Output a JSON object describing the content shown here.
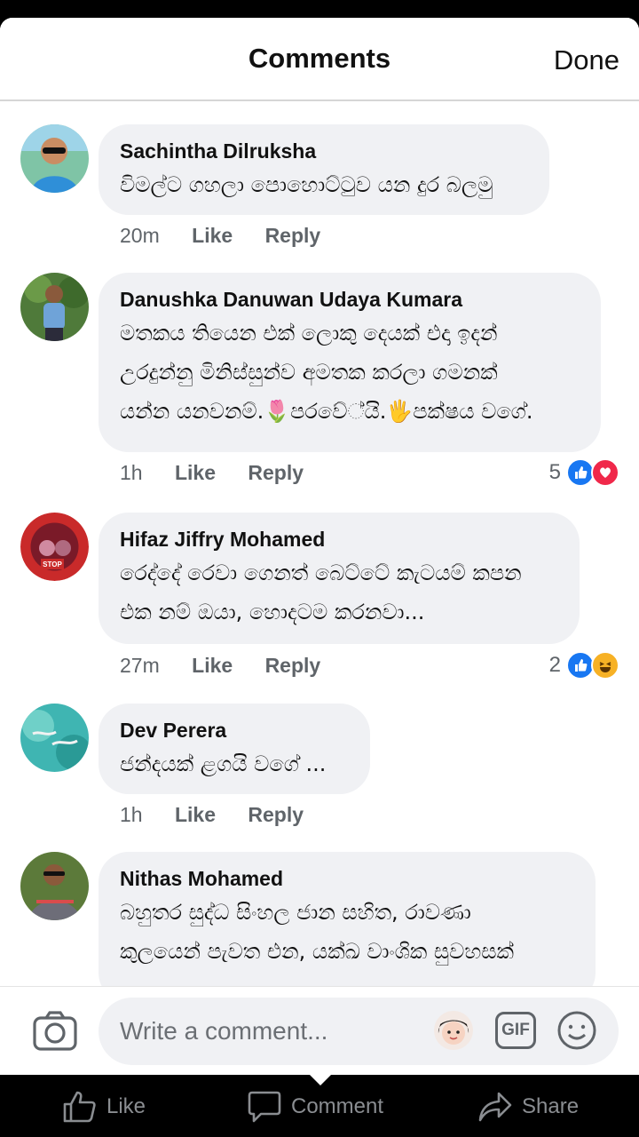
{
  "header": {
    "title": "Comments",
    "done_label": "Done"
  },
  "comments": [
    {
      "author": "Sachintha Dilruksha",
      "lines": [
        "විමල්ට ගහලා පොහොට්ටුව යන දුර බලමු"
      ],
      "time": "20m",
      "like_label": "Like",
      "reply_label": "Reply",
      "reactions": null
    },
    {
      "author": "Danushka Danuwan Udaya Kumara",
      "lines": [
        "මතකය තියෙන එක් ලොකු දෙයක් එදා ඉදන්",
        "උරදුන්නු මිනිස්සුන්ව අමතක කරලා ගමනක්",
        "යන්න යනවනම්.🌷පරවේ්යි.🖐පක්ෂය වගේ."
      ],
      "time": "1h",
      "like_label": "Like",
      "reply_label": "Reply",
      "reactions": {
        "count": "5",
        "types": [
          "like",
          "love"
        ]
      }
    },
    {
      "author": "Hifaz Jiffry Mohamed",
      "lines": [
        "රෙද්දේ රෙවා ගෙනත් බෙට්ටේ කැටයම් කපන",
        "එක නම් ඔයා, හොදටම කරනවා..."
      ],
      "time": "27m",
      "like_label": "Like",
      "reply_label": "Reply",
      "reactions": {
        "count": "2",
        "types": [
          "like",
          "haha"
        ]
      }
    },
    {
      "author": "Dev Perera",
      "lines": [
        "ජන්දයක් ළගයි වගේ ..."
      ],
      "time": "1h",
      "like_label": "Like",
      "reply_label": "Reply",
      "reactions": null
    },
    {
      "author": "Nithas Mohamed",
      "lines": [
        "බහුතර සුද්ධ සිංහල ජාන සහිත, රාවණා",
        "කුලයෙන් පැවත එන, යක්ඛ වාංශික සුවහසක්"
      ],
      "time": "",
      "like_label": "",
      "reply_label": "",
      "reactions": null
    }
  ],
  "composer": {
    "placeholder": "Write a comment...",
    "gif_label": "GIF"
  },
  "bottom_bar": {
    "like_label": "Like",
    "comment_label": "Comment",
    "share_label": "Share"
  },
  "colors": {
    "bubble": "#f0f1f4",
    "like_blue": "#1877f2",
    "love_red": "#f0284a",
    "haha_yellow": "#f7b125"
  },
  "icons": [
    "camera-icon",
    "avatar-sticker-icon",
    "gif-icon",
    "smile-icon",
    "thumbs-up-icon",
    "comment-icon",
    "share-icon"
  ]
}
